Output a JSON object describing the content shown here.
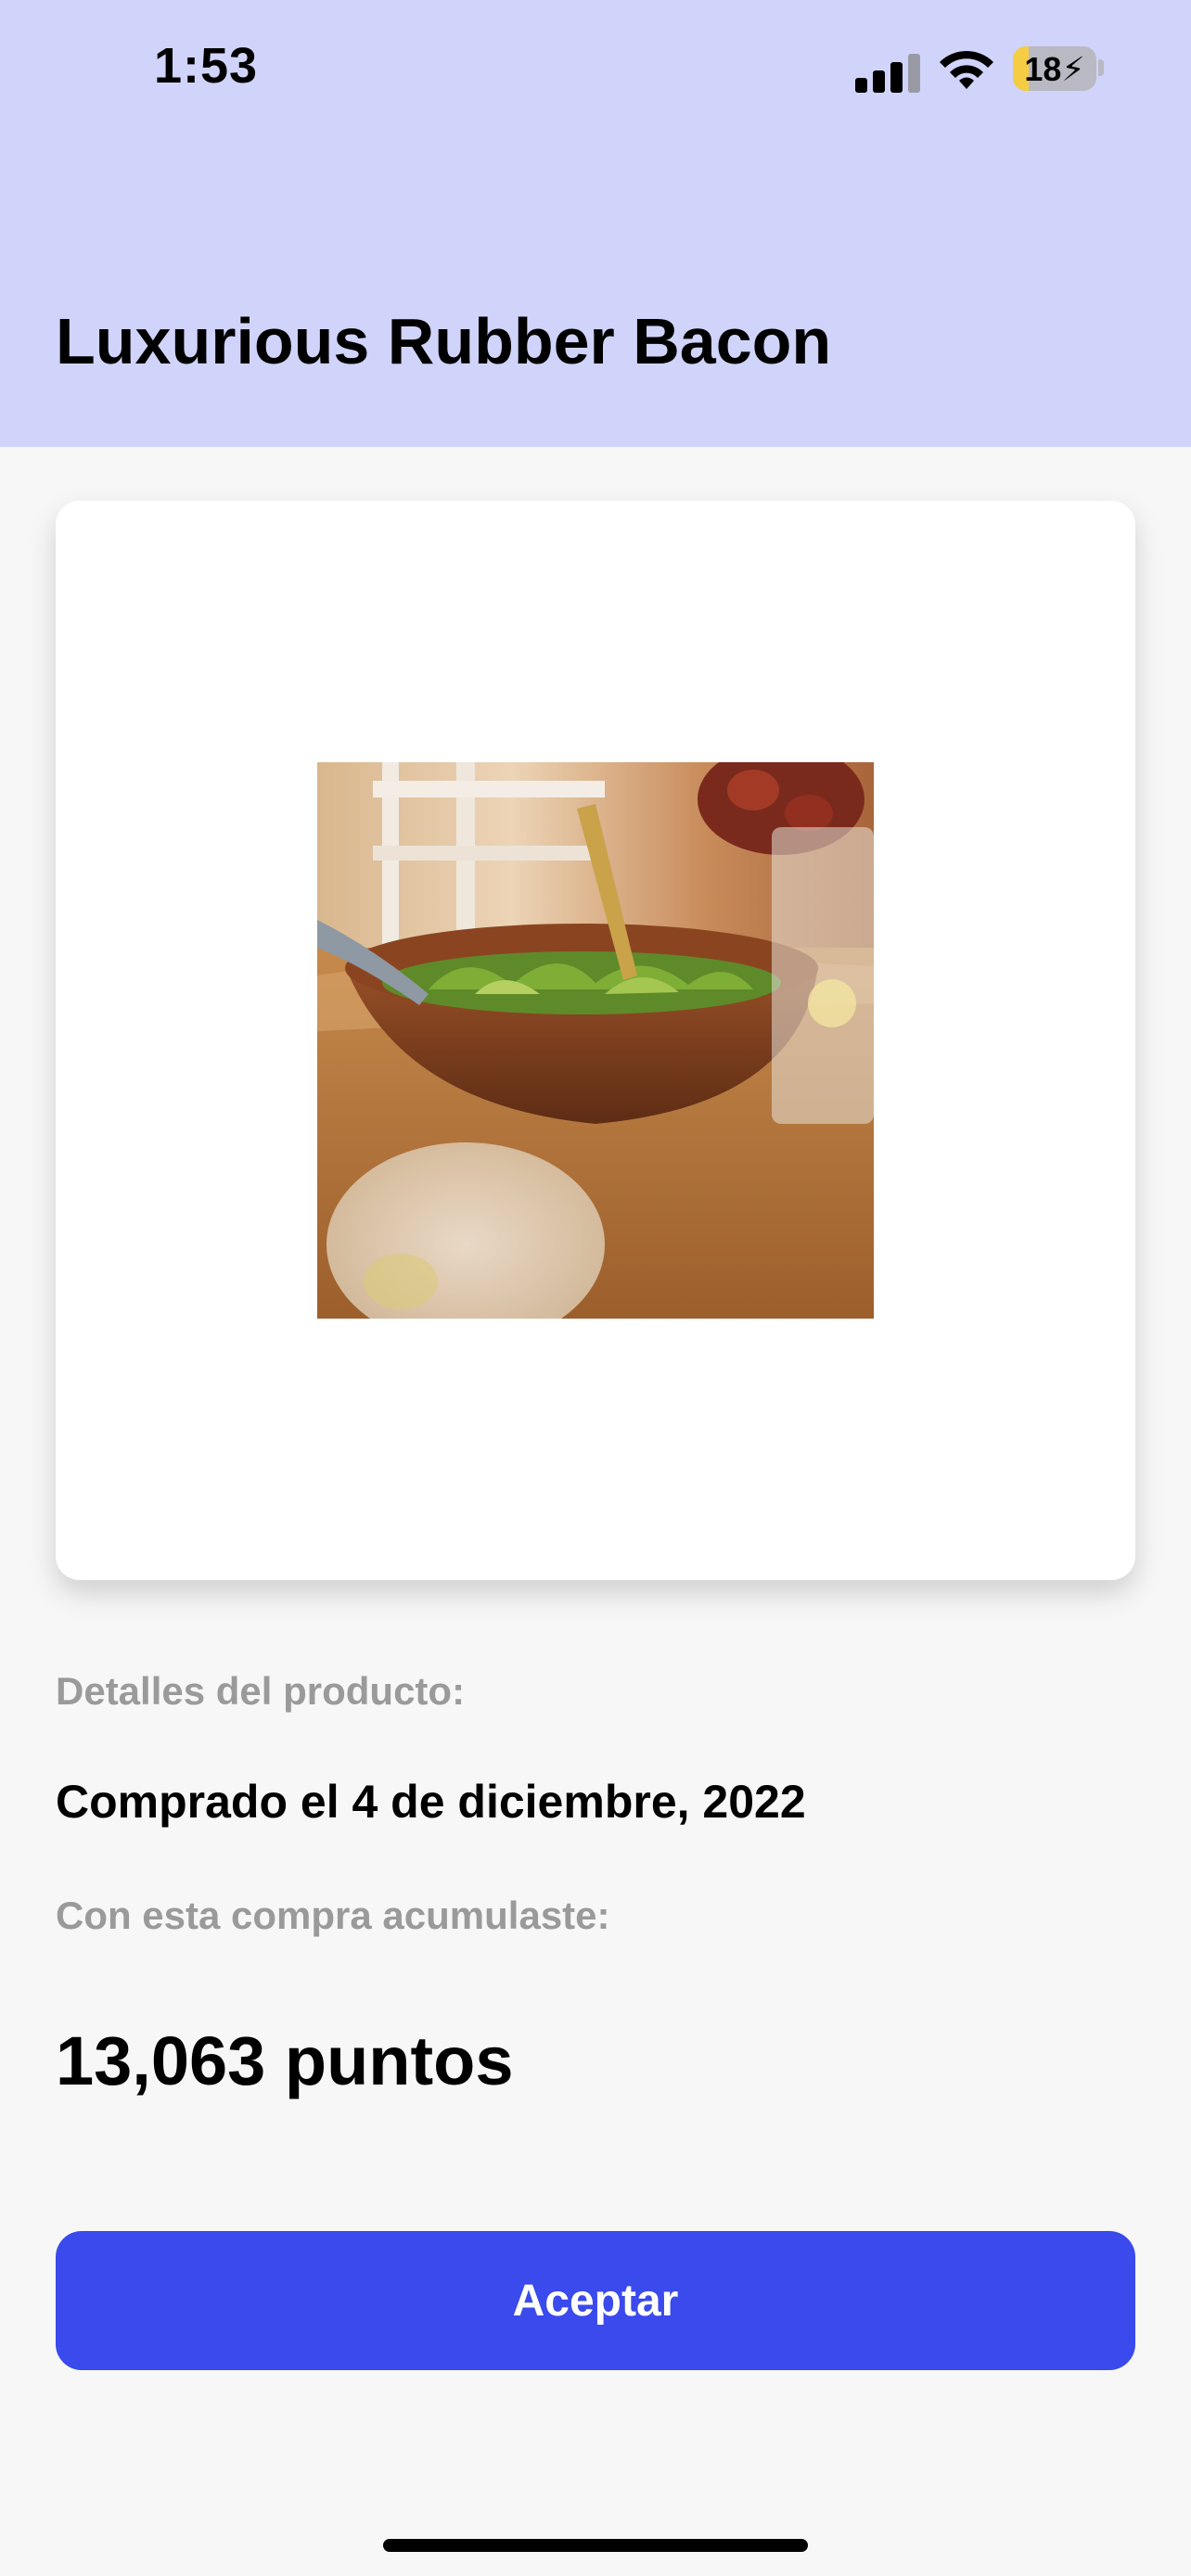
{
  "status_bar": {
    "time": "1:53",
    "battery": "18",
    "icons": [
      "signal-icon",
      "wifi-icon",
      "battery-icon"
    ]
  },
  "header": {
    "title": "Luxurious Rubber Bacon",
    "background_color": "#d0d4fa"
  },
  "product": {
    "image_description_icon": "salad-bowl-photo",
    "details_label": "Detalles del producto:",
    "purchase_date": "Comprado el 4 de diciembre, 2022",
    "points_label": "Con esta compra acumulaste:",
    "points_value": "13,063 puntos"
  },
  "actions": {
    "accept_label": "Aceptar",
    "accent_color": "#3a4aec"
  }
}
